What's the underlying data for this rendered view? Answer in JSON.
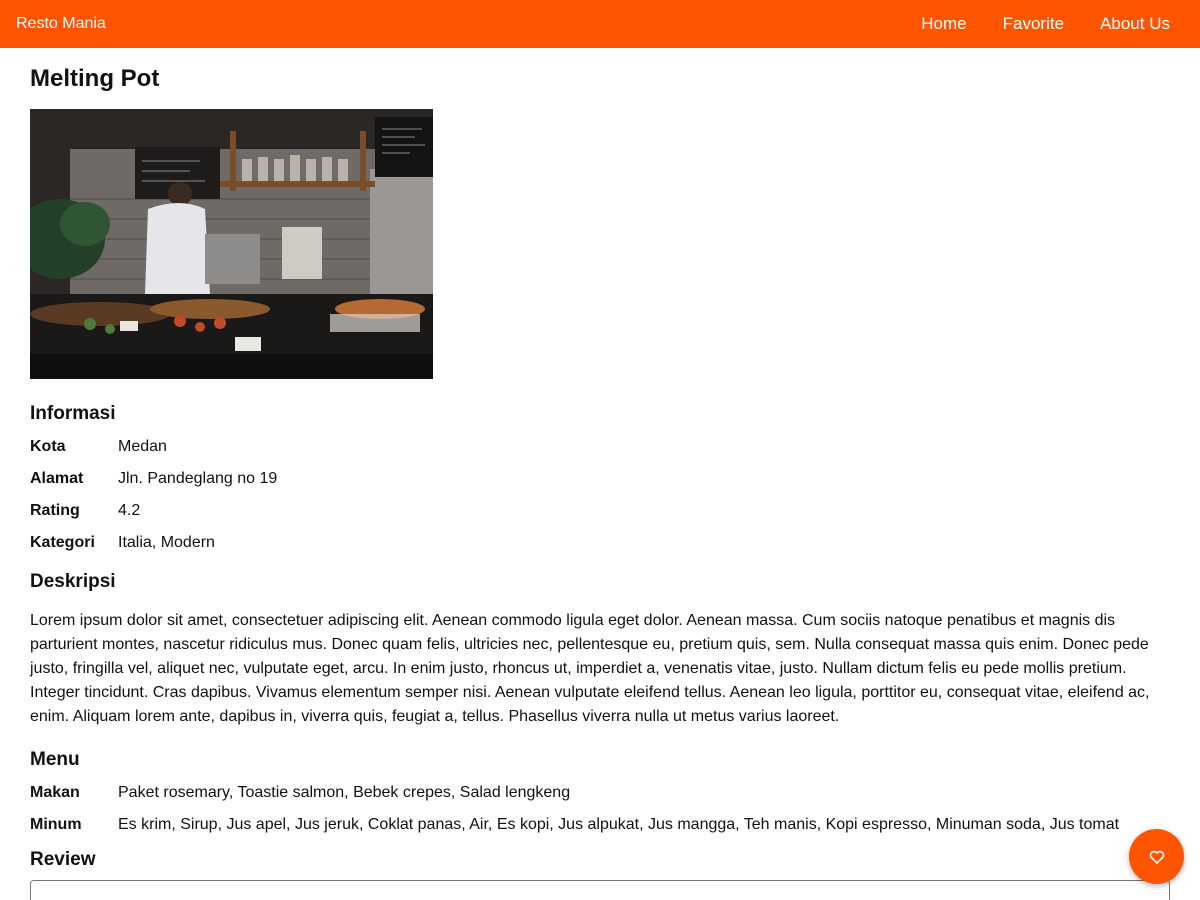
{
  "navbar": {
    "brand": "Resto Mania",
    "links": [
      "Home",
      "Favorite",
      "About Us"
    ]
  },
  "restaurant": {
    "name": "Melting Pot",
    "image_alt": "Restaurant kitchen counter"
  },
  "info": {
    "heading": "Informasi",
    "rows": [
      {
        "label": "Kota",
        "value": "Medan"
      },
      {
        "label": "Alamat",
        "value": "Jln. Pandeglang no 19"
      },
      {
        "label": "Rating",
        "value": "4.2"
      },
      {
        "label": "Kategori",
        "value": "Italia, Modern"
      }
    ]
  },
  "description": {
    "heading": "Deskripsi",
    "text": "Lorem ipsum dolor sit amet, consectetuer adipiscing elit. Aenean commodo ligula eget dolor. Aenean massa. Cum sociis natoque penatibus et magnis dis parturient montes, nascetur ridiculus mus. Donec quam felis, ultricies nec, pellentesque eu, pretium quis, sem. Nulla consequat massa quis enim. Donec pede justo, fringilla vel, aliquet nec, vulputate eget, arcu. In enim justo, rhoncus ut, imperdiet a, venenatis vitae, justo. Nullam dictum felis eu pede mollis pretium. Integer tincidunt. Cras dapibus. Vivamus elementum semper nisi. Aenean vulputate eleifend tellus. Aenean leo ligula, porttitor eu, consequat vitae, eleifend ac, enim. Aliquam lorem ante, dapibus in, viverra quis, feugiat a, tellus. Phasellus viverra nulla ut metus varius laoreet."
  },
  "menu": {
    "heading": "Menu",
    "rows": [
      {
        "label": "Makan",
        "value": "Paket rosemary, Toastie salmon, Bebek crepes, Salad lengkeng"
      },
      {
        "label": "Minum",
        "value": "Es krim, Sirup, Jus apel, Jus jeruk, Coklat panas, Air, Es kopi, Jus alpukat, Jus mangga, Teh manis, Kopi espresso, Minuman soda, Jus tomat"
      }
    ]
  },
  "review": {
    "heading": "Review"
  },
  "fab": {
    "icon": "heart-icon"
  },
  "colors": {
    "primary": "#ff5500",
    "text": "#111111"
  }
}
